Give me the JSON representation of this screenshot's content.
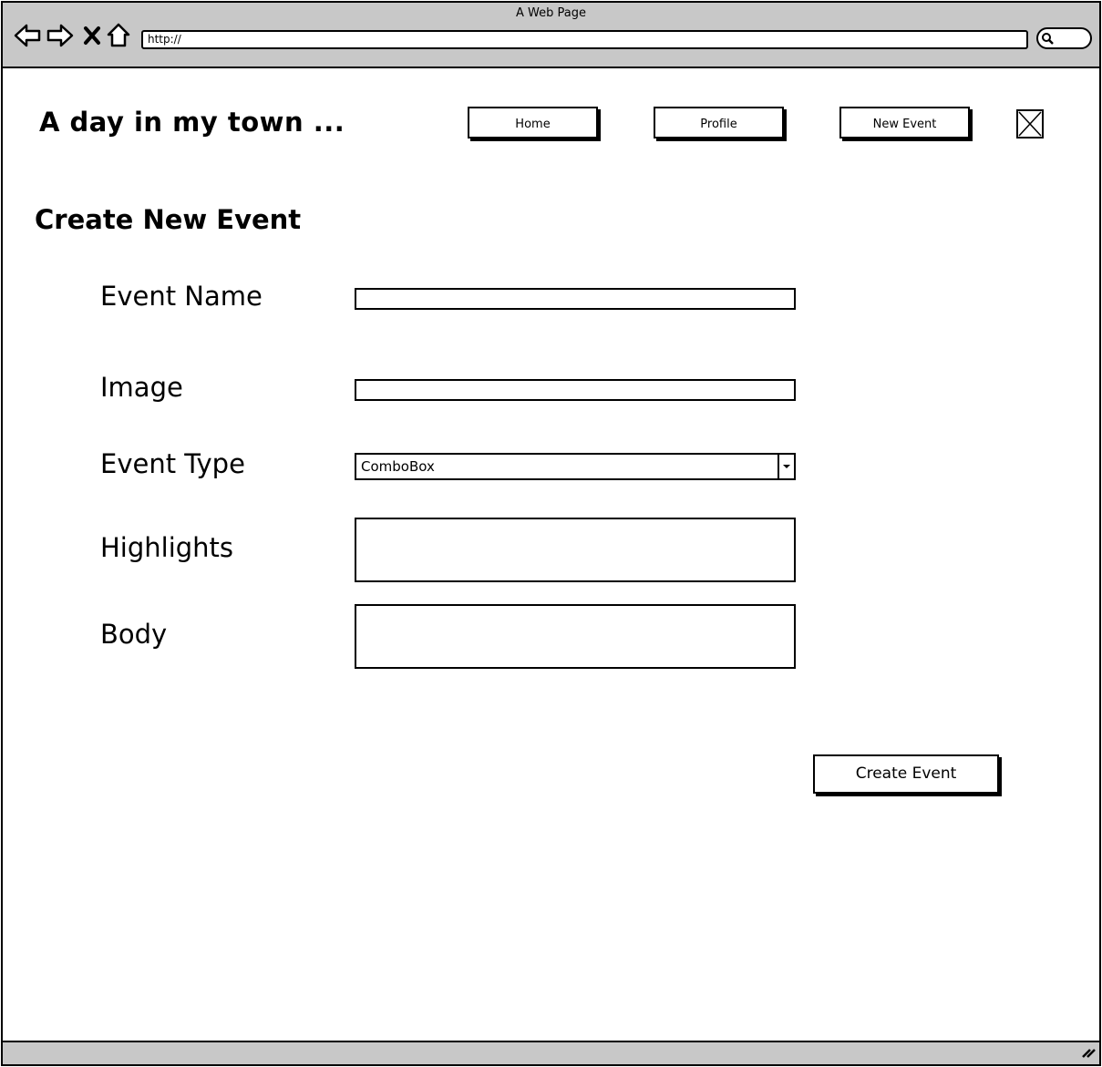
{
  "browser": {
    "title": "A Web Page",
    "url": "http://"
  },
  "header": {
    "brand": "A day in my town ...",
    "nav": [
      "Home",
      "Profile",
      "New Event"
    ]
  },
  "form": {
    "title": "Create New Event",
    "fields": {
      "event_name": {
        "label": "Event Name",
        "value": ""
      },
      "image": {
        "label": "Image",
        "value": ""
      },
      "event_type": {
        "label": "Event Type",
        "value": "ComboBox"
      },
      "highlights": {
        "label": "Highlights",
        "value": ""
      },
      "body": {
        "label": "Body",
        "value": ""
      }
    },
    "submit_label": "Create Event"
  },
  "icons": [
    "back-arrow-icon",
    "forward-arrow-icon",
    "stop-icon",
    "home-icon",
    "search-icon",
    "image-placeholder-icon",
    "chevron-down-icon",
    "resize-grip-icon"
  ]
}
